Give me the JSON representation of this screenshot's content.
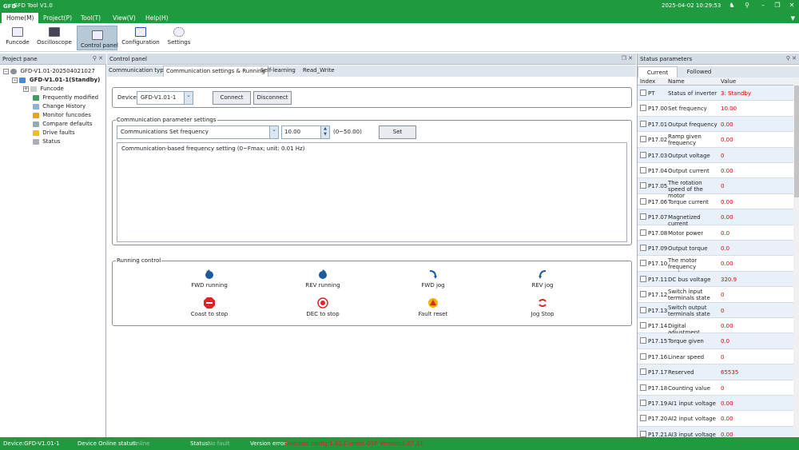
{
  "app": {
    "title": "GFD Tool V1.0",
    "logo": "GFD",
    "clock": "2025-04-02 10:29:53"
  },
  "menu": [
    "Home(M)",
    "Project(P)",
    "Tool(T)",
    "View(V)",
    "Help(H)"
  ],
  "toolbar": [
    "Funcode",
    "Oscilloscope",
    "Control panel",
    "Configuration",
    "Settings"
  ],
  "project_pane": {
    "title": "Project pane",
    "root": "GFD-V1.01-202504021027",
    "device": "GFD-V1.01-1(Standby)",
    "items": [
      "Funcode",
      "Frequently modified",
      "Change History",
      "Monitor funcodes",
      "Compare defaults",
      "Drive faults",
      "Status"
    ]
  },
  "control_panel": {
    "title": "Control panel",
    "tabs": [
      "Communication type",
      "Communication settings & Running",
      "Self-learning",
      "Read_Write"
    ],
    "device_label": "Device",
    "device_value": "GFD-V1.01-1",
    "connect": "Connect",
    "disconnect": "Disconnect",
    "comm_group": "Communication parameter settings",
    "param_select": "Communications Set frequency",
    "param_value": "10.00",
    "param_range": "(0~50.00)",
    "set": "Set",
    "description": "Communication-based frequency setting (0~Fmax; unit: 0.01 Hz)",
    "running_group": "Running control",
    "controls": [
      "FWD running",
      "REV running",
      "FWD jog",
      "REV jog",
      "Coast to stop",
      "DEC to stop",
      "Fault reset",
      "Jog Stop"
    ]
  },
  "status_pane": {
    "title": "Status parameters",
    "tabs": [
      "Current",
      "Followed"
    ],
    "columns": [
      "Index",
      "Name",
      "Value"
    ],
    "rows": [
      {
        "index": "PT",
        "name": "Status of inverter",
        "value": "3: Standby"
      },
      {
        "index": "P17.00",
        "name": "Set frequency",
        "value": "10.00"
      },
      {
        "index": "P17.01",
        "name": "Output frequency",
        "value": "0.00"
      },
      {
        "index": "P17.02",
        "name": "Ramp given frequency",
        "value": "0.00"
      },
      {
        "index": "P17.03",
        "name": "Output voltage",
        "value": "0"
      },
      {
        "index": "P17.04",
        "name": "Output current",
        "value": "0.00"
      },
      {
        "index": "P17.05",
        "name": "The rotation speed of the motor",
        "value": "0"
      },
      {
        "index": "P17.06",
        "name": "Torque current",
        "value": "0.00"
      },
      {
        "index": "P17.07",
        "name": "Magnetized current",
        "value": "0.00"
      },
      {
        "index": "P17.08",
        "name": "Motor power",
        "value": "0.0"
      },
      {
        "index": "P17.09",
        "name": "Output torque",
        "value": "0.0"
      },
      {
        "index": "P17.10",
        "name": "The motor frequency evalua...",
        "value": "0.00"
      },
      {
        "index": "P17.11",
        "name": "DC bus voltage",
        "value": "320.9"
      },
      {
        "index": "P17.12",
        "name": "Switch input terminals state",
        "value": "0"
      },
      {
        "index": "P17.13",
        "name": "Switch output terminals state",
        "value": "0"
      },
      {
        "index": "P17.14",
        "name": "Digital adjustment",
        "value": "0.00"
      },
      {
        "index": "P17.15",
        "name": "Torque given",
        "value": "0.0"
      },
      {
        "index": "P17.16",
        "name": "Linear speed",
        "value": "0"
      },
      {
        "index": "P17.17",
        "name": "Reserved",
        "value": "65535"
      },
      {
        "index": "P17.18",
        "name": "Counting value",
        "value": "0"
      },
      {
        "index": "P17.19",
        "name": "AI1 input voltage",
        "value": "0.00"
      },
      {
        "index": "P17.20",
        "name": "AI2 input voltage",
        "value": "0.00"
      },
      {
        "index": "P17.21",
        "name": "AI3 input voltage",
        "value": "0.00"
      }
    ]
  },
  "statusbar": {
    "device": "Device:GFD-V1.01-1",
    "online_label": "Device Online status:",
    "online_value": "Online",
    "status_label": "Status:",
    "status_value": "No fault",
    "version_label": "Version error:",
    "version_value": "Selected config:1.01,Current DSP Version:1.07.11"
  },
  "colors": {
    "brand": "#1f9a3e",
    "value_red": "#e00000",
    "accent_blue": "#1e5aa0"
  },
  "icons": [
    "minimize-icon",
    "maximize-icon",
    "close-icon",
    "pin-icon"
  ]
}
